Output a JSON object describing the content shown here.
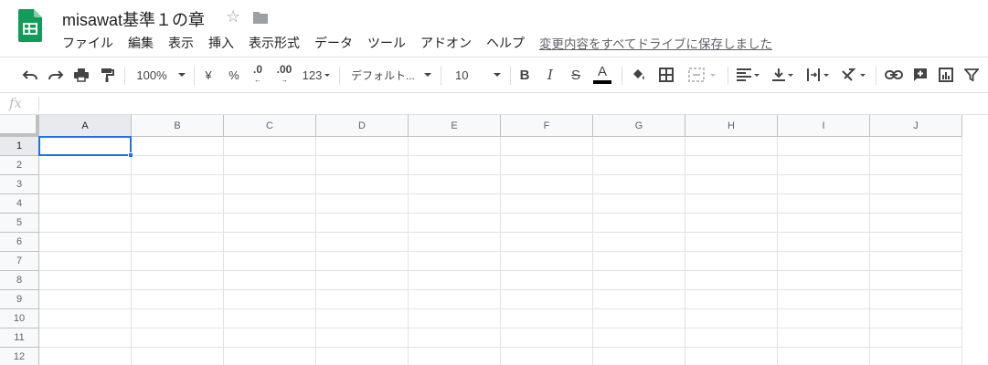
{
  "header": {
    "title": "misawat基準１の章",
    "star_icon": "star-outline-icon",
    "folder_icon": "folder-icon",
    "saved_status": "変更内容をすべてドライブに保存しました"
  },
  "menu": [
    "ファイル",
    "編集",
    "表示",
    "挿入",
    "表示形式",
    "データ",
    "ツール",
    "アドオン",
    "ヘルプ"
  ],
  "toolbar": {
    "zoom": "100%",
    "currency": "¥",
    "percent": "%",
    "decimal_decrease": ".0",
    "decimal_increase": ".00",
    "more_formats": "123",
    "font": "デフォルト...",
    "font_size": "10",
    "text_color_bar": "#000000"
  },
  "formula_bar": {
    "label": "fx",
    "value": ""
  },
  "sheet": {
    "columns": [
      "A",
      "B",
      "C",
      "D",
      "E",
      "F",
      "G",
      "H",
      "I",
      "J"
    ],
    "rows": [
      "1",
      "2",
      "3",
      "4",
      "5",
      "6",
      "7",
      "8",
      "9",
      "10",
      "11",
      "12"
    ],
    "selected_cell": "A1"
  },
  "colors": {
    "selection": "#1a73e8",
    "logo_green": "#0f9d58"
  }
}
